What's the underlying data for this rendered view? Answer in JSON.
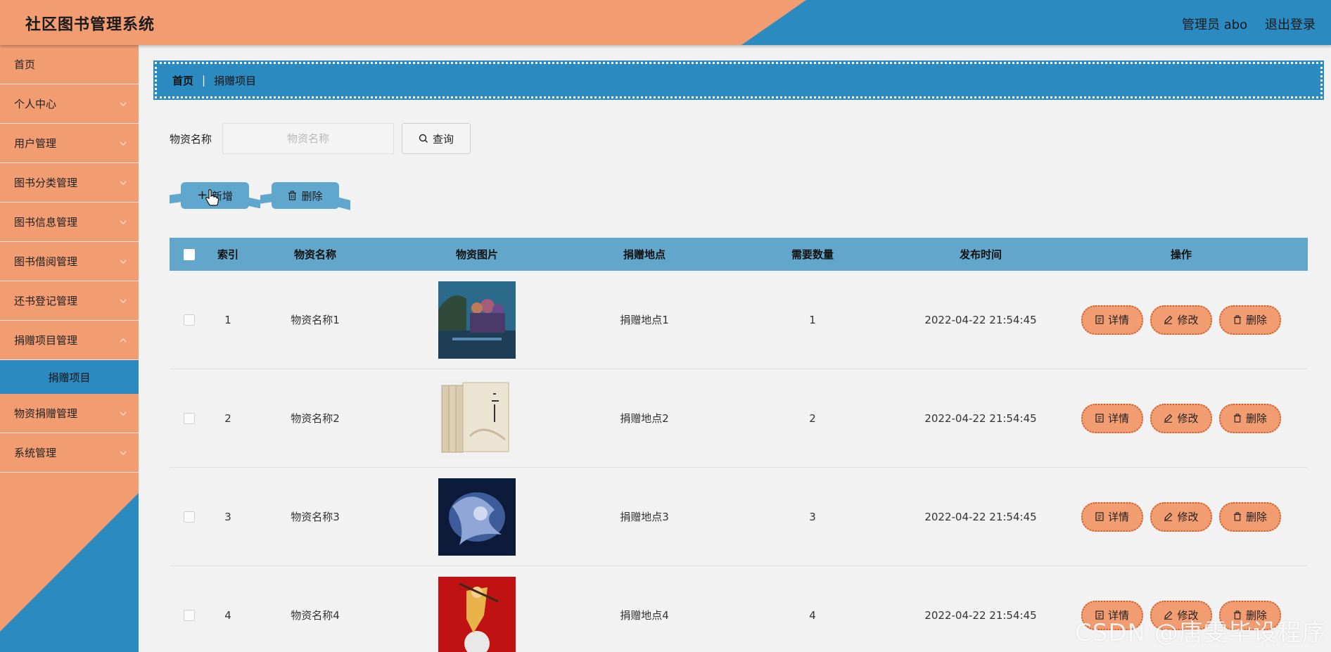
{
  "app": {
    "title": "社区图书管理系统",
    "user_label": "管理员 abo",
    "logout_label": "退出登录"
  },
  "colors": {
    "orange": "#f29c71",
    "blue": "#2b8bc0",
    "table_header": "#62a7cb"
  },
  "sidebar": {
    "items": [
      {
        "label": "首页",
        "has_chevron": false
      },
      {
        "label": "个人中心",
        "has_chevron": true
      },
      {
        "label": "用户管理",
        "has_chevron": true
      },
      {
        "label": "图书分类管理",
        "has_chevron": true
      },
      {
        "label": "图书信息管理",
        "has_chevron": true
      },
      {
        "label": "图书借阅管理",
        "has_chevron": true
      },
      {
        "label": "还书登记管理",
        "has_chevron": true
      },
      {
        "label": "捐赠项目管理",
        "has_chevron": true,
        "expanded": true
      },
      {
        "label": "捐赠项目",
        "active_sub": true
      },
      {
        "label": "物资捐赠管理",
        "has_chevron": true
      },
      {
        "label": "系统管理",
        "has_chevron": true
      }
    ]
  },
  "breadcrumb": {
    "home": "首页",
    "separator": "|",
    "current": "捐赠项目"
  },
  "search": {
    "label": "物资名称",
    "placeholder": "物资名称",
    "value": "",
    "button_label": "查询"
  },
  "actions": {
    "add_label": "新增",
    "delete_label": "删除"
  },
  "table": {
    "headers": {
      "index": "索引",
      "name": "物资名称",
      "image": "物资图片",
      "location": "捐赠地点",
      "quantity": "需要数量",
      "time": "发布时间",
      "ops": "操作"
    },
    "op_labels": {
      "detail": "详情",
      "edit": "修改",
      "delete": "删除"
    },
    "rows": [
      {
        "index": "1",
        "name": "物资名称1",
        "image": "book-cover-characters",
        "location": "捐赠地点1",
        "quantity": "1",
        "time": "2022-04-22 21:54:45"
      },
      {
        "index": "2",
        "name": "物资名称2",
        "image": "book-box-set",
        "location": "捐赠地点2",
        "quantity": "2",
        "time": "2022-04-22 21:54:45"
      },
      {
        "index": "3",
        "name": "物资名称3",
        "image": "book-cover-dragon",
        "location": "捐赠地点3",
        "quantity": "3",
        "time": "2022-04-22 21:54:45"
      },
      {
        "index": "4",
        "name": "物资名称4",
        "image": "book-cover-red",
        "location": "捐赠地点4",
        "quantity": "4",
        "time": "2022-04-22 21:54:45"
      }
    ]
  },
  "watermark": "CSDN @唐雯毕设程序"
}
